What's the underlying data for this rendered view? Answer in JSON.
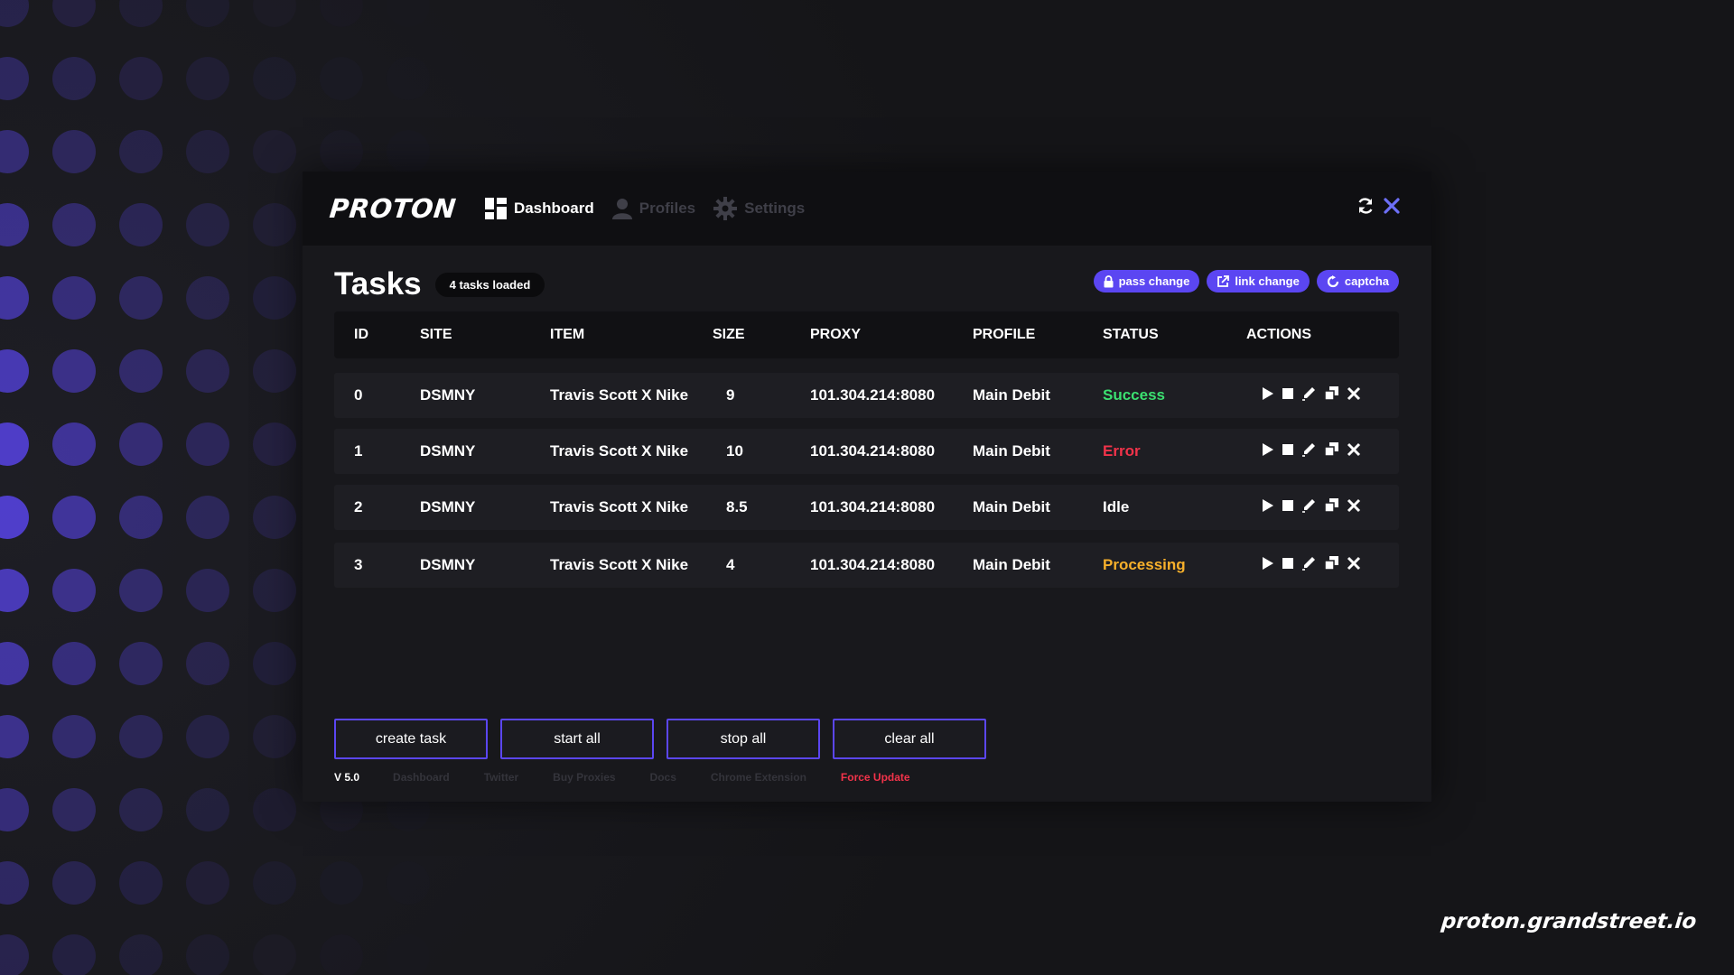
{
  "app": {
    "logo": "PROTON",
    "url": "proton.grandstreet.io"
  },
  "nav": {
    "items": [
      {
        "label": "Dashboard",
        "icon": "dashboard-icon",
        "active": true
      },
      {
        "label": "Profiles",
        "icon": "user-icon",
        "active": false
      },
      {
        "label": "Settings",
        "icon": "gear-icon",
        "active": false
      }
    ]
  },
  "top_actions": {
    "refresh_icon": "refresh-icon",
    "close_icon": "close-icon"
  },
  "tasks": {
    "title": "Tasks",
    "count_label": "4 tasks loaded",
    "badges": [
      {
        "label": "pass change",
        "icon": "lock-icon"
      },
      {
        "label": "link change",
        "icon": "external-link-icon"
      },
      {
        "label": "captcha",
        "icon": "captcha-icon"
      }
    ],
    "columns": [
      "ID",
      "SITE",
      "ITEM",
      "SIZE",
      "PROXY",
      "PROFILE",
      "STATUS",
      "ACTIONS"
    ],
    "rows": [
      {
        "id": "0",
        "site": "DSMNY",
        "item": "Travis Scott X Nike",
        "size": "9",
        "proxy": "101.304.214:8080",
        "profile": "Main Debit",
        "status": "Success",
        "status_color": "#3be070"
      },
      {
        "id": "1",
        "site": "DSMNY",
        "item": "Travis Scott X Nike",
        "size": "10",
        "proxy": "101.304.214:8080",
        "profile": "Main Debit",
        "status": "Error",
        "status_color": "#f2334a"
      },
      {
        "id": "2",
        "site": "DSMNY",
        "item": "Travis Scott X Nike",
        "size": "8.5",
        "proxy": "101.304.214:8080",
        "profile": "Main Debit",
        "status": "Idle",
        "status_color": "#ffffff"
      },
      {
        "id": "3",
        "site": "DSMNY",
        "item": "Travis Scott X Nike",
        "size": "4",
        "proxy": "101.304.214:8080",
        "profile": "Main Debit",
        "status": "Processing",
        "status_color": "#f7b02b"
      }
    ],
    "row_actions": [
      "play-icon",
      "stop-icon",
      "edit-icon",
      "duplicate-icon",
      "delete-icon"
    ]
  },
  "buttons": {
    "create": "create task",
    "start_all": "start all",
    "stop_all": "stop all",
    "clear_all": "clear all"
  },
  "footer": {
    "version": "V 5.0",
    "links": [
      "Dashboard",
      "Twitter",
      "Buy Proxies",
      "Docs",
      "Chrome Extension"
    ],
    "force_update": "Force Update"
  },
  "colors": {
    "accent": "#5b46f2",
    "background": "#151518",
    "panel": "#18181c",
    "success": "#3be070",
    "error": "#f2334a",
    "processing": "#f7b02b"
  }
}
